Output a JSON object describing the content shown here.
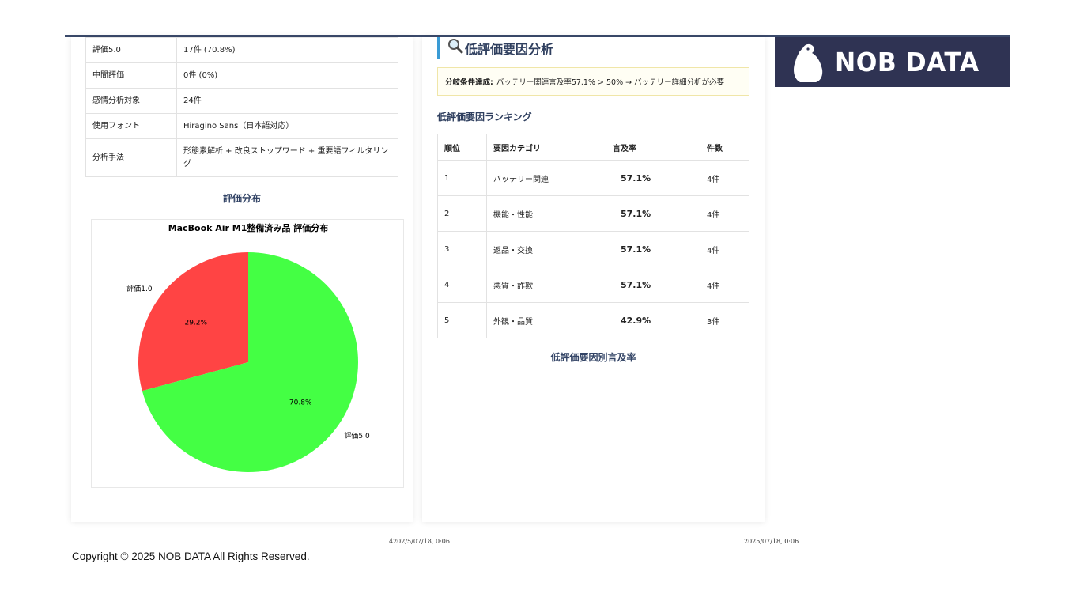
{
  "info_rows": [
    {
      "key": "評価5.0",
      "value": "17件 (70.8%)"
    },
    {
      "key": "中間評価",
      "value": "0件 (0%)"
    },
    {
      "key": "感情分析対象",
      "value": "24件"
    },
    {
      "key": "使用フォント",
      "value": "Hiragino Sans（日本語対応）"
    },
    {
      "key": "分析手法",
      "value": "形態素解析 + 改良ストップワード + 重要語フィルタリング"
    }
  ],
  "distribution_title": "評価分布",
  "chart_data": {
    "type": "pie",
    "title": "MacBook Air M1整備済み品 評価分布",
    "slices": [
      {
        "label": "評価1.0",
        "value": 29.2,
        "pct_label": "29.2%",
        "color": "#ff4444"
      },
      {
        "label": "評価5.0",
        "value": 70.8,
        "pct_label": "70.8%",
        "color": "#44ff44"
      }
    ]
  },
  "analysis": {
    "icon": "magnifier-icon",
    "heading": "低評価要因分析",
    "branch_label": "分岐条件達成:",
    "branch_text": "バッテリー関連言及率57.1% > 50% → バッテリー詳細分析が必要",
    "ranking_title": "低評価要因ランキング",
    "headers": [
      "順位",
      "要因カテゴリ",
      "言及率",
      "件数"
    ],
    "rows": [
      {
        "rank": "1",
        "category": "バッテリー関連",
        "rate": "57.1%",
        "count": "4件"
      },
      {
        "rank": "2",
        "category": "機能・性能",
        "rate": "57.1%",
        "count": "4件"
      },
      {
        "rank": "3",
        "category": "返品・交換",
        "rate": "57.1%",
        "count": "4件"
      },
      {
        "rank": "4",
        "category": "悪質・詐欺",
        "rate": "57.1%",
        "count": "4件"
      },
      {
        "rank": "5",
        "category": "外観・品質",
        "rate": "42.9%",
        "count": "3件"
      }
    ],
    "rate_chart_title": "低評価要因別言及率"
  },
  "logo": {
    "text": "NOB DATA",
    "icon": "bird-logo-icon"
  },
  "footer": {
    "stamp_left": "4202/5/07/18, 0:06",
    "stamp_right": "2025/07/18, 0:06",
    "copyright": "Copyright © 2025 NOB DATA All Rights Reserved."
  }
}
